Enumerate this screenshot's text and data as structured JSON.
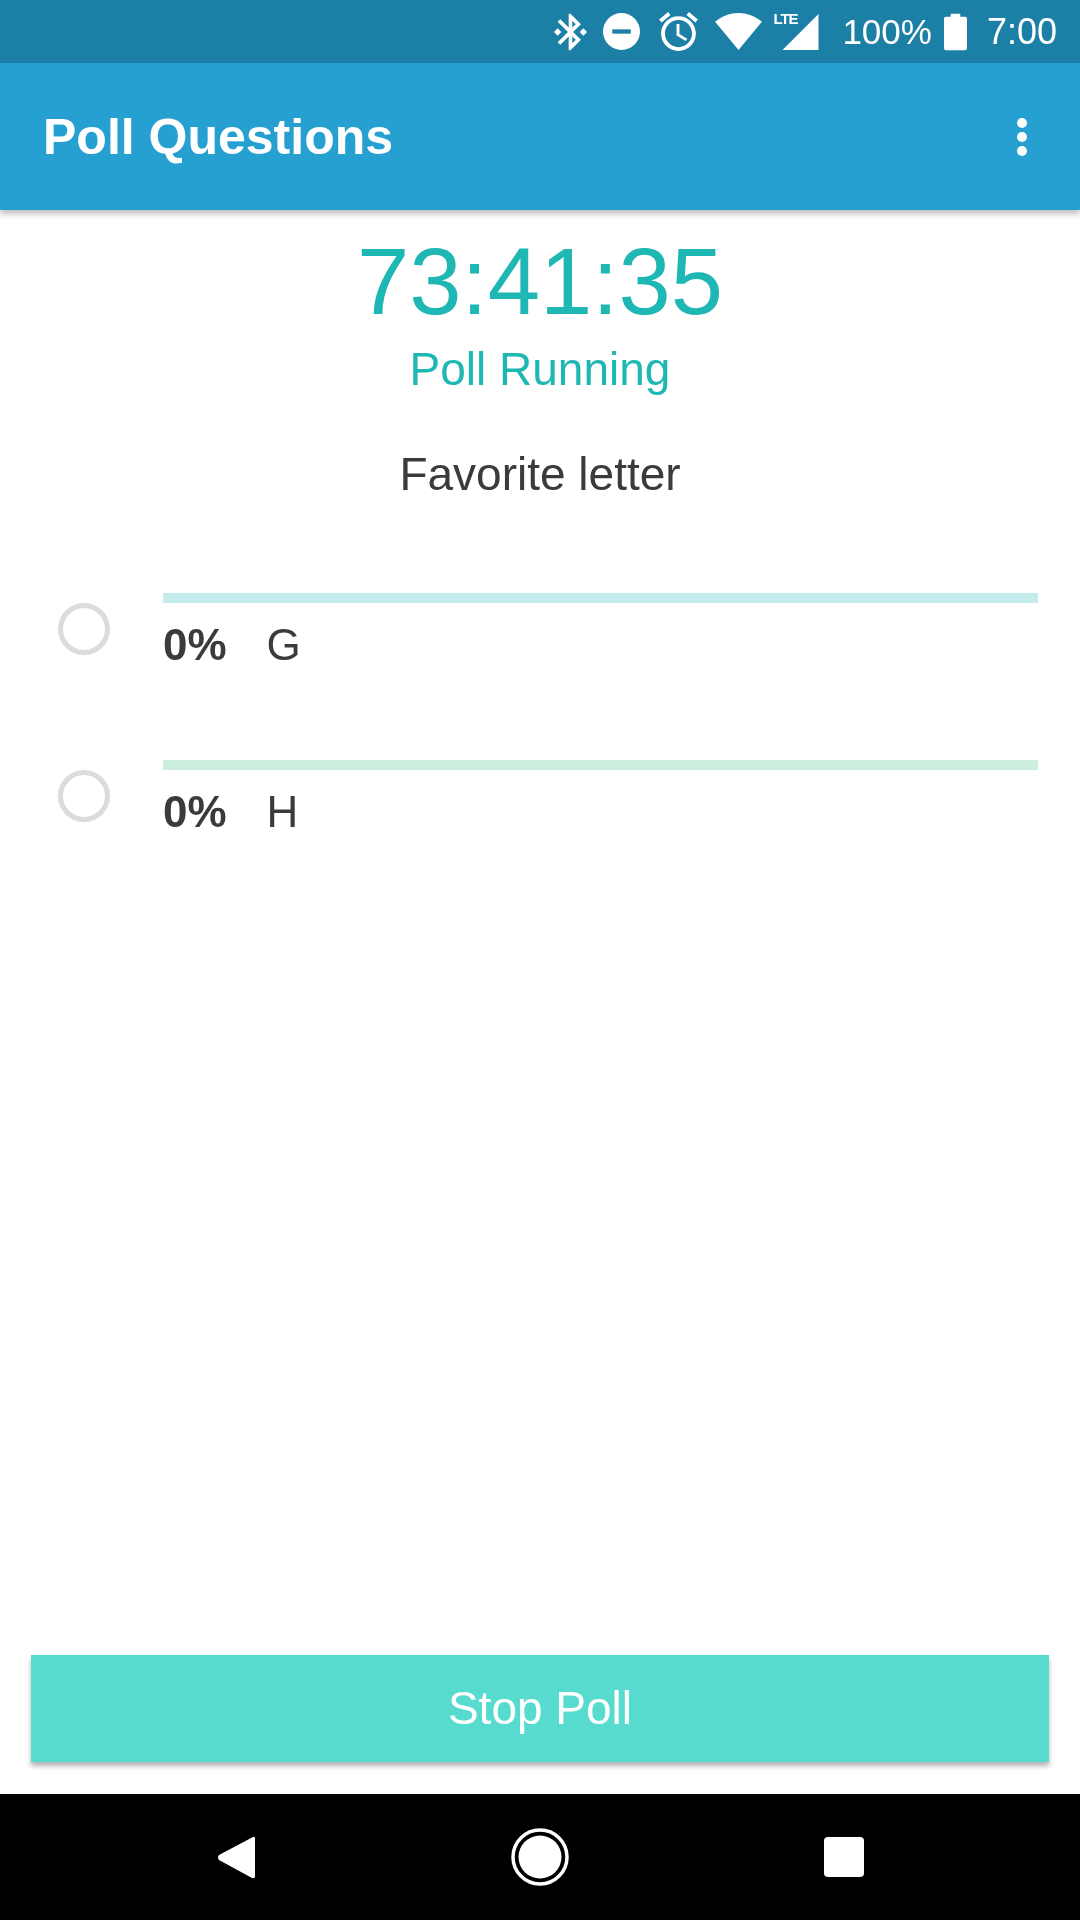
{
  "status_bar": {
    "network_label": "LTE",
    "battery": "100%",
    "time": "7:00"
  },
  "app_bar": {
    "title": "Poll Questions"
  },
  "poll": {
    "timer": "73:41:35",
    "status": "Poll Running",
    "question": "Favorite letter",
    "options": [
      {
        "percent": "0%",
        "label": "G",
        "selected": false,
        "color": "#c5ecec"
      },
      {
        "percent": "0%",
        "label": "H",
        "selected": false,
        "color": "#cbeede"
      }
    ]
  },
  "actions": {
    "stop_button": "Stop Poll"
  }
}
